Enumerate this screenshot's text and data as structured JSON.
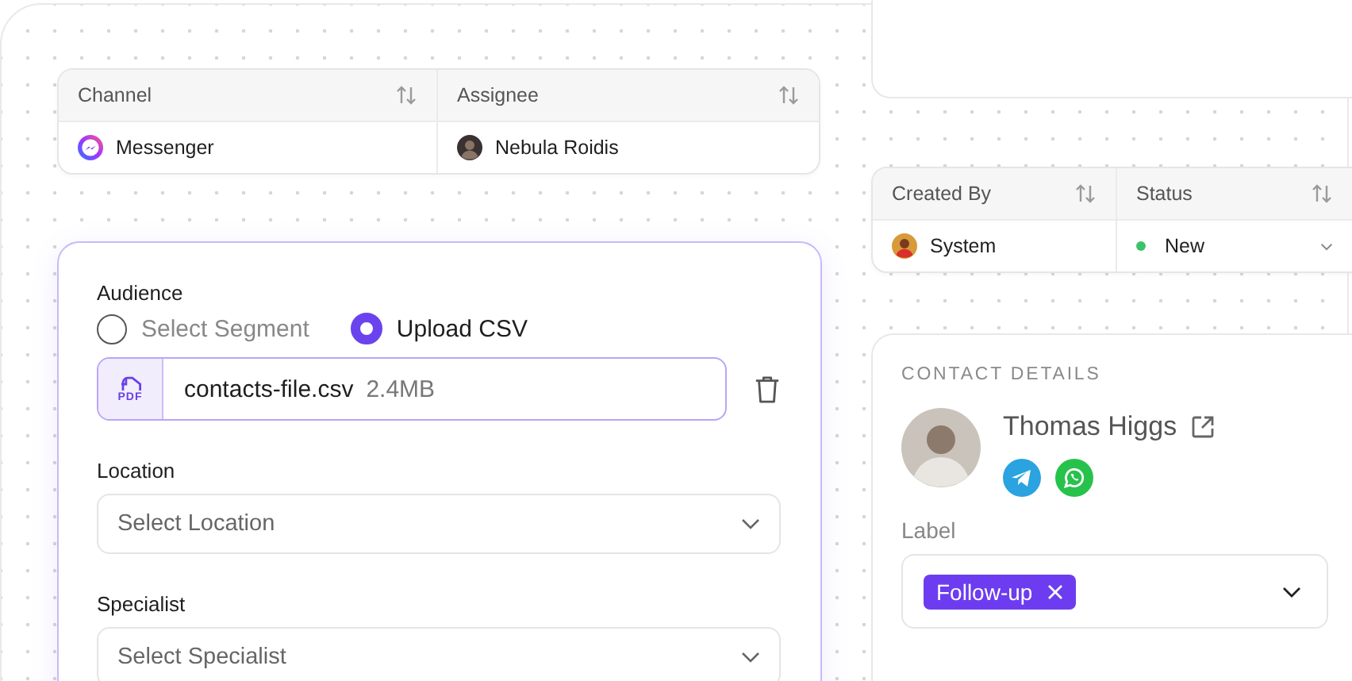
{
  "assignment_table": {
    "columns": [
      {
        "label": "Channel"
      },
      {
        "label": "Assignee"
      }
    ],
    "row": {
      "channel": "Messenger",
      "assignee": "Nebula Roidis"
    }
  },
  "creator_table": {
    "columns": [
      {
        "label": "Created By"
      },
      {
        "label": "Status"
      }
    ],
    "row": {
      "created_by": "System",
      "status": {
        "label": "New",
        "color": "#3cc36a"
      }
    }
  },
  "audience_form": {
    "title": "Audience",
    "options": [
      {
        "label": "Select Segment",
        "selected": false
      },
      {
        "label": "Upload CSV",
        "selected": true
      }
    ],
    "file": {
      "type_badge": "PDF",
      "name": "contacts-file.csv",
      "size": "2.4MB"
    },
    "fields": [
      {
        "label": "Location",
        "placeholder": "Select Location"
      },
      {
        "label": "Specialist",
        "placeholder": "Select Specialist"
      }
    ]
  },
  "contact_details": {
    "heading": "CONTACT DETAILS",
    "name": "Thomas Higgs",
    "label_title": "Label",
    "tags": [
      {
        "label": "Follow-up"
      }
    ]
  }
}
